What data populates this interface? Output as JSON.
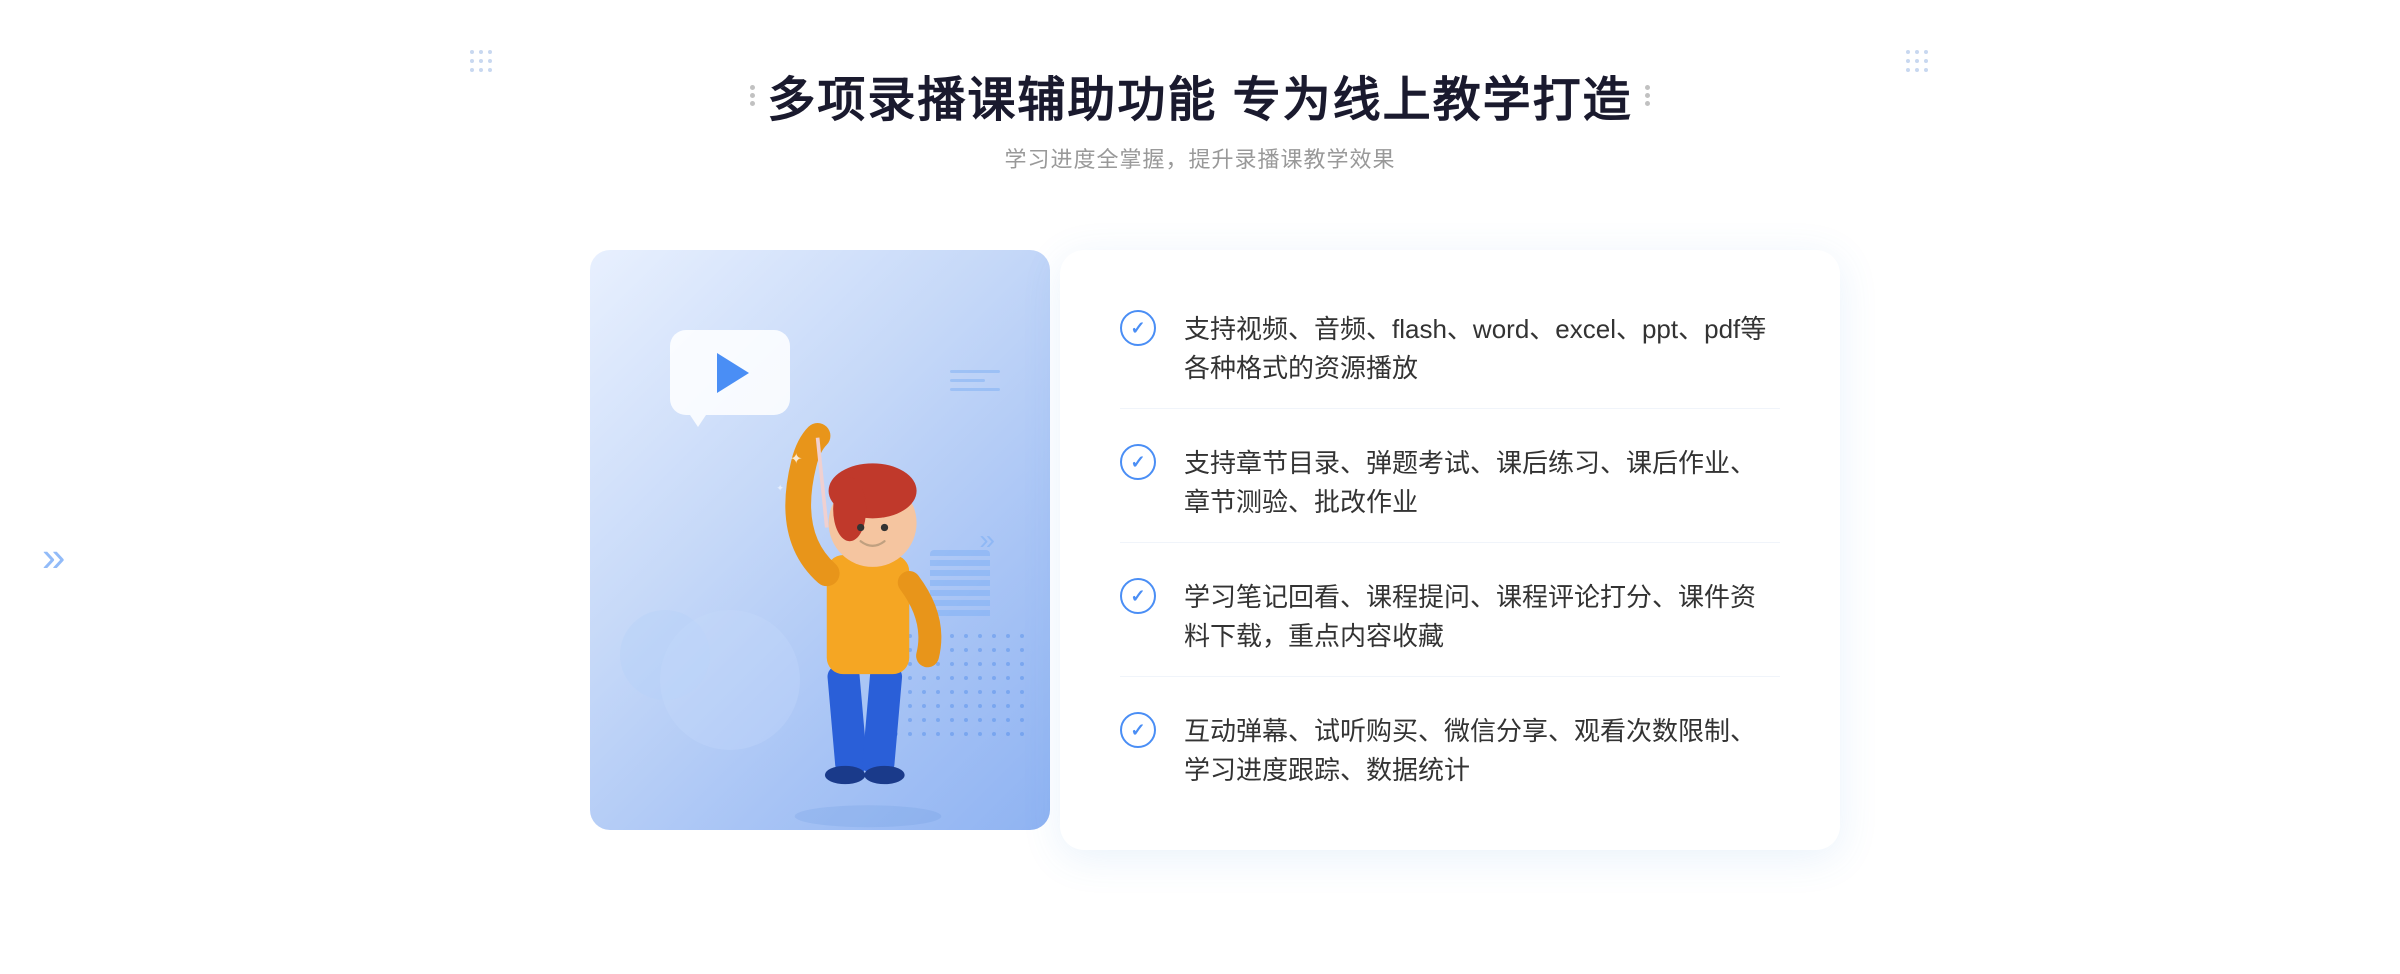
{
  "header": {
    "title": "多项录播课辅助功能 专为线上教学打造",
    "subtitle": "学习进度全掌握，提升录播课教学效果"
  },
  "features": [
    {
      "id": "feature-1",
      "text": "支持视频、音频、flash、word、excel、ppt、pdf等各种格式的资源播放"
    },
    {
      "id": "feature-2",
      "text": "支持章节目录、弹题考试、课后练习、课后作业、章节测验、批改作业"
    },
    {
      "id": "feature-3",
      "text": "学习笔记回看、课程提问、课程评论打分、课件资料下载，重点内容收藏"
    },
    {
      "id": "feature-4",
      "text": "互动弹幕、试听购买、微信分享、观看次数限制、学习进度跟踪、数据统计"
    }
  ],
  "decorations": {
    "chevron": "»",
    "check_symbol": "✓"
  }
}
